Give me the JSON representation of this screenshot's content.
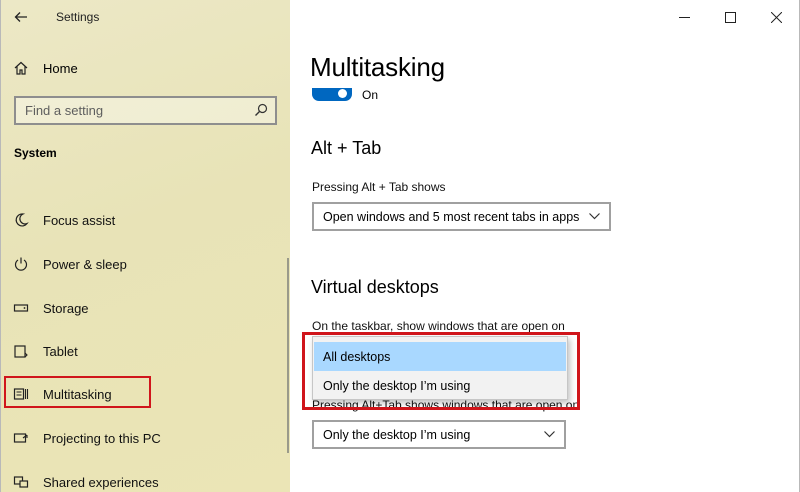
{
  "window": {
    "title": "Settings"
  },
  "sidebar": {
    "home_label": "Home",
    "search_placeholder": "Find a setting",
    "section_title": "System",
    "items": [
      {
        "label": "Focus assist",
        "icon": "moon-icon"
      },
      {
        "label": "Power & sleep",
        "icon": "power-icon"
      },
      {
        "label": "Storage",
        "icon": "storage-icon"
      },
      {
        "label": "Tablet",
        "icon": "tablet-icon"
      },
      {
        "label": "Multitasking",
        "icon": "multitasking-icon"
      },
      {
        "label": "Projecting to this PC",
        "icon": "projecting-icon"
      },
      {
        "label": "Shared experiences",
        "icon": "shared-experiences-icon"
      }
    ],
    "selected": "Multitasking"
  },
  "main": {
    "page_title": "Multitasking",
    "toggle": {
      "state": "On",
      "label": "On"
    },
    "alt_tab": {
      "heading": "Alt + Tab",
      "label": "Pressing Alt + Tab shows",
      "value": "Open windows and 5 most recent tabs in apps"
    },
    "virtual_desktops": {
      "heading": "Virtual desktops",
      "taskbar_label": "On the taskbar, show windows that are open on",
      "taskbar_options": [
        "All desktops",
        "Only the desktop I’m using"
      ],
      "taskbar_selected": "All desktops",
      "alt_tab_label": "Pressing Alt+Tab shows windows that are open on",
      "alt_tab_value": "Only the desktop I’m using"
    }
  },
  "colors": {
    "accent": "#0067c0",
    "highlight_red": "#d0151b",
    "selected_option": "#a9d8ff"
  }
}
